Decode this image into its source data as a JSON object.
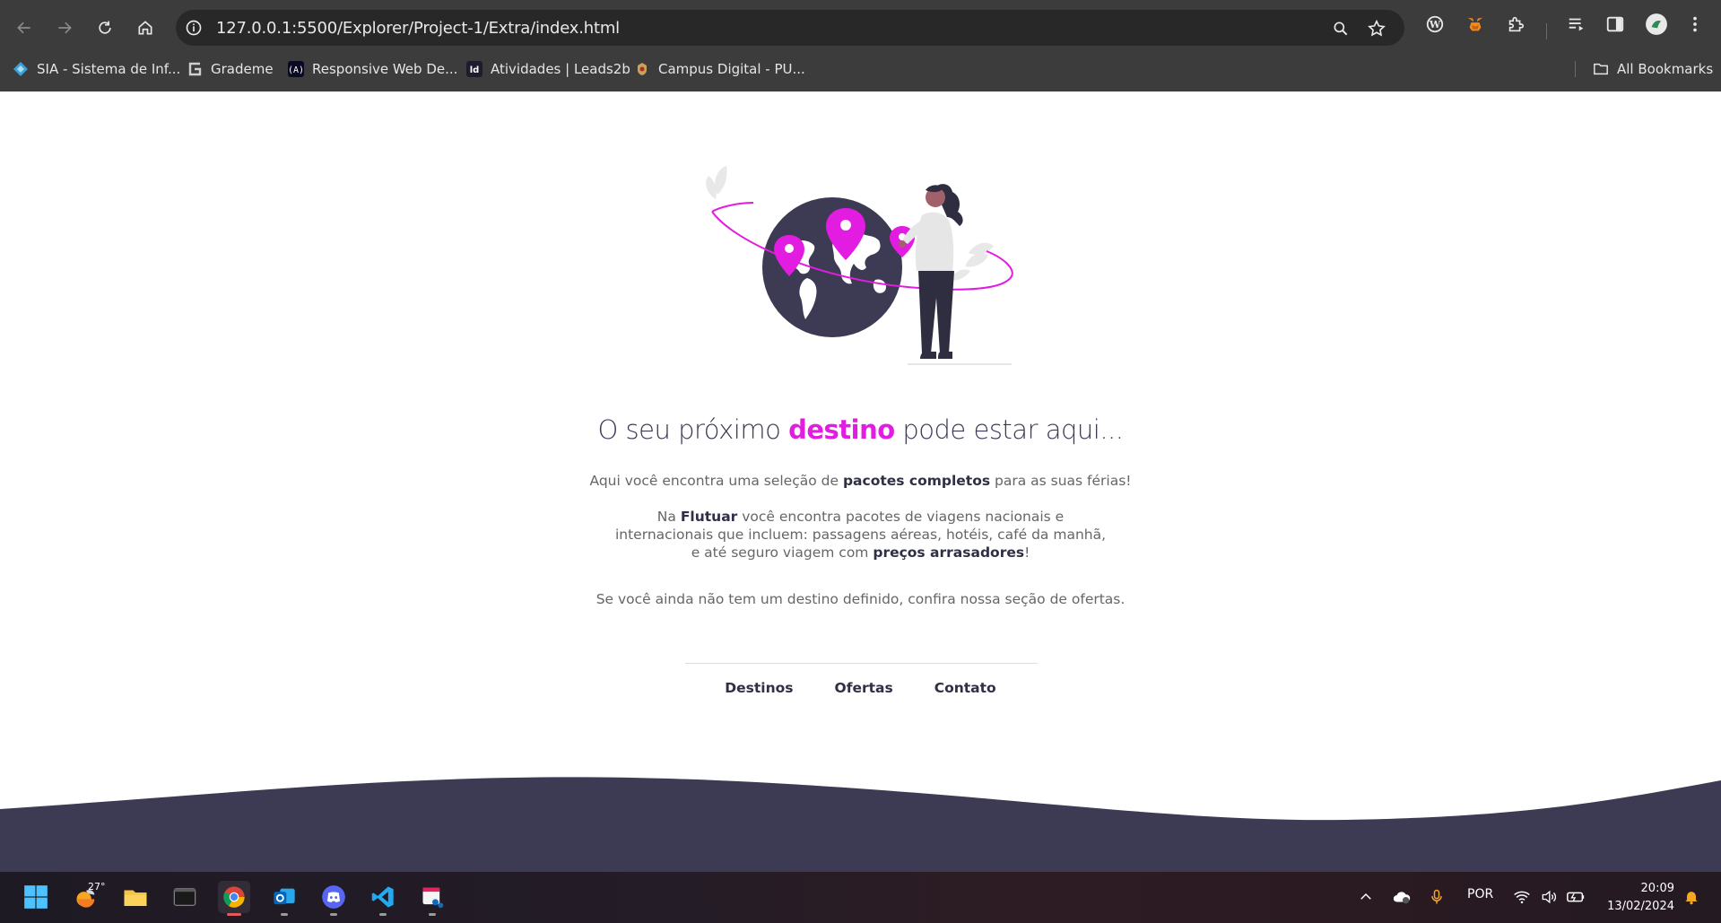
{
  "browser": {
    "url": "127.0.0.1:5500/Explorer/Project-1/Extra/index.html",
    "bookmarks": [
      {
        "label": "SIA - Sistema de Inf...",
        "icon": "sia-icon"
      },
      {
        "label": "Grademe",
        "icon": "grademe-icon"
      },
      {
        "label": "Responsive Web De...",
        "icon": "freecodecamp-icon"
      },
      {
        "label": "Atividades | Leads2b",
        "icon": "leads2b-icon"
      },
      {
        "label": "Campus Digital - PU...",
        "icon": "campus-icon"
      }
    ],
    "all_bookmarks_label": "All Bookmarks"
  },
  "page": {
    "headline_pre": "O seu próximo ",
    "headline_highlight": "destino",
    "headline_post": " pode estar aqui...",
    "p1_pre": "Aqui você encontra uma seleção de ",
    "p1_bold": "pacotes completos",
    "p1_post": " para as suas férias!",
    "p2_pre": "Na ",
    "p2_bold1": "Flutuar",
    "p2_mid": " você encontra pacotes de viagens nacionais e internacionais que incluem: passagens aéreas, hotéis, café da manhã, e até seguro viagem com ",
    "p2_bold2": "preços arrasadores",
    "p2_post": "!",
    "p3": "Se você ainda não tem um destino definido, confira nossa seção de ofertas.",
    "nav": [
      "Destinos",
      "Ofertas",
      "Contato"
    ],
    "colors": {
      "accent": "#e21ce0",
      "dark": "#3d3a53"
    }
  },
  "taskbar": {
    "weather_temp": "27°",
    "language": "POR",
    "time": "20:09",
    "date": "13/02/2024"
  }
}
